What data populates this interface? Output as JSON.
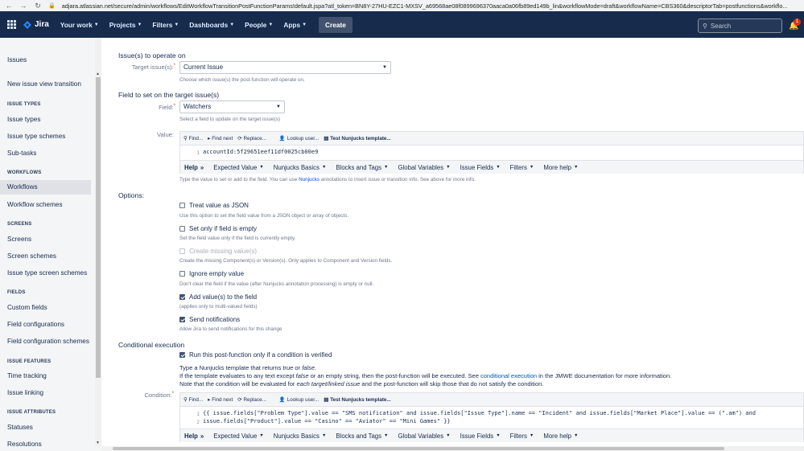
{
  "browser": {
    "url": "adjara.atlassian.net/secure/admin/workflows/EditWorkflowTransitionPostFunctionParams!default.jspa?atl_token=BN8Y-27HU-EZC1-MXSV_a69568ae08f0899696370aaca0a06fb89ed149b_lin&workflowMode=draft&workflowName=CBS360&descriptorTab=postfunctions&workflo..."
  },
  "topnav": {
    "logo": "Jira",
    "menus": [
      "Your work",
      "Projects",
      "Filters",
      "Dashboards",
      "People",
      "Apps"
    ],
    "create": "Create",
    "search_placeholder": "Search",
    "notification_count": "1"
  },
  "sidebar": {
    "title": "Issues",
    "new_issue_view": "New issue view transition",
    "groups": [
      {
        "heading": "ISSUE TYPES",
        "items": [
          "Issue types",
          "Issue type schemes",
          "Sub-tasks"
        ]
      },
      {
        "heading": "WORKFLOWS",
        "items": [
          "Workflows",
          "Workflow schemes"
        ]
      },
      {
        "heading": "SCREENS",
        "items": [
          "Screens",
          "Screen schemes",
          "Issue type screen schemes"
        ]
      },
      {
        "heading": "FIELDS",
        "items": [
          "Custom fields",
          "Field configurations",
          "Field configuration schemes"
        ]
      },
      {
        "heading": "ISSUE FEATURES",
        "items": [
          "Time tracking",
          "Issue linking"
        ]
      },
      {
        "heading": "ISSUE ATTRIBUTES",
        "items": [
          "Statuses",
          "Resolutions"
        ]
      }
    ],
    "active": "Workflows"
  },
  "main": {
    "issues_section": "Issue(s) to operate on",
    "target_label": "Target issue(s):",
    "target_value": "Current Issue",
    "target_hint": "Choose which issue(s) the post-function will operate on.",
    "field_section": "Field to set on the target issue(s)",
    "field_label": "Field:",
    "field_value": "Watchers",
    "field_hint": "Select a field to update on the target issue(s)",
    "value_label": "Value:",
    "toolbar": [
      "Find...",
      "Find next",
      "Replace...",
      "Lookup user...",
      "Test Nunjucks template..."
    ],
    "value_code": "accountId:5f29651eef11df0025cb00e9",
    "helpbar": [
      "Help",
      "Expected Value",
      "Nunjucks Basics",
      "Blocks and Tags",
      "Global Variables",
      "Issue Fields",
      "Filters",
      "More help"
    ],
    "value_hint_pre": "Type the value to set or add to the field. You can use ",
    "value_hint_link": "Nunjucks",
    "value_hint_post": " annotations to insert issue or transition info. See above for more info.",
    "options_title": "Options:",
    "options": [
      {
        "label": "Treat value as JSON",
        "hint": "Use this option to set the field value from a JSON object or array of objects.",
        "checked": false,
        "disabled": false
      },
      {
        "label": "Set only if field is empty",
        "hint": "Set the field value only if the field is currently empty.",
        "checked": false,
        "disabled": false
      },
      {
        "label": "Create missing value(s)",
        "hint": "Create the missing Component(s) or Version(s). Only applies to Component and Version fields.",
        "checked": false,
        "disabled": true
      },
      {
        "label": "Ignore empty value",
        "hint": "Don't clear the field if the value (after Nunjucks annotation processing) is empty or null.",
        "checked": false,
        "disabled": false
      },
      {
        "label": "Add value(s) to the field",
        "hint": "(applies only to multi-valued fields)",
        "checked": true,
        "disabled": false
      },
      {
        "label": "Send notifications",
        "hint": "Allow Jira to send notifications for this change",
        "checked": true,
        "disabled": false
      }
    ],
    "conditional_title": "Conditional execution",
    "conditional_checkbox": "Run this post-function only if a condition is verified",
    "cond_para1_pre": "Type a Nunjucks template that returns ",
    "cond_para1_true": "true",
    "cond_para1_mid": " or ",
    "cond_para1_false": "false",
    "cond_para1_end": ".",
    "cond_para2_pre": "If the template evaluates to any text except ",
    "cond_para2_false": "false",
    "cond_para2_mid": " or an empty string, then the post-function will be executed. See ",
    "cond_para2_link": "conditional execution",
    "cond_para2_post": " in the JMWE documentation for more information.",
    "cond_para3_pre": "Note that the condition will be evaluated for ",
    "cond_para3_em": "each target/linked issue",
    "cond_para3_post": " and the post-function will skip those that do not satisfy the condition.",
    "condition_label": "Condition:",
    "condition_line1": "{{ issue.fields[\"Problem Type\"].value == \"SMS notification\" and issue.fields[\"Issue Type\"].name == \"Incident\" and issue.fields[\"Market Place\"].value == (\".am\") and",
    "condition_line2": "issue.fields[\"Product\"].value == \"Casino\" == \"Aviator\" == \"Mini Games\" }}"
  }
}
